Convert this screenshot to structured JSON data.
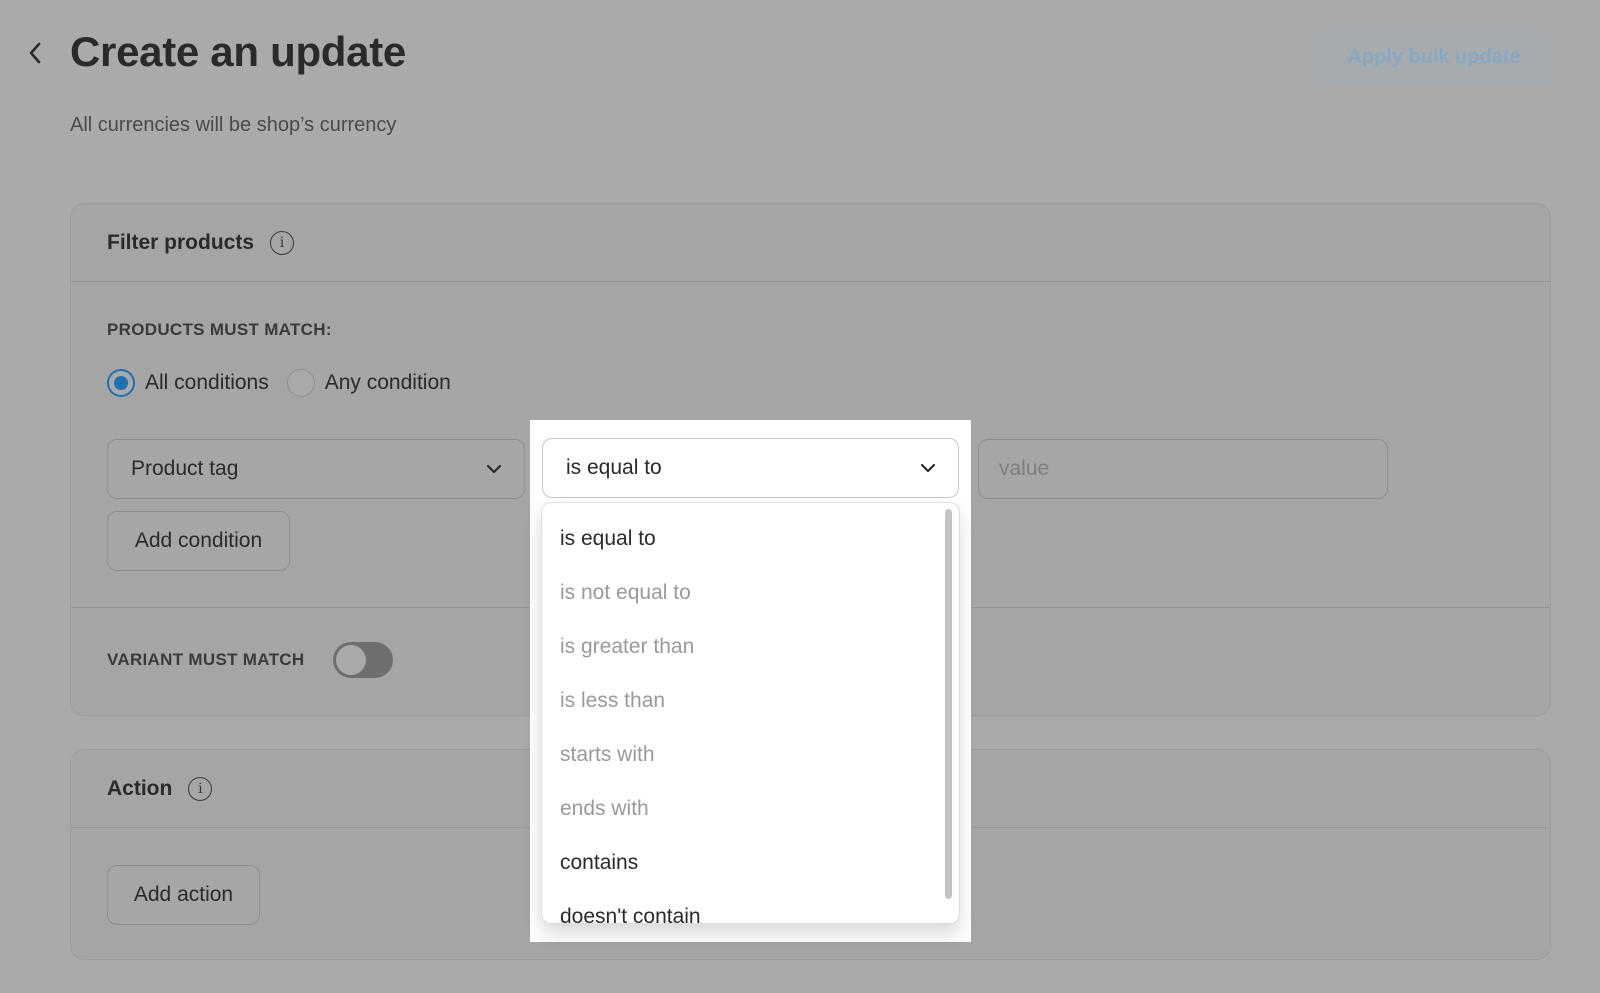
{
  "header": {
    "title": "Create an update",
    "subtitle": "All currencies will be shop’s currency",
    "apply_button": "Apply bulk update"
  },
  "filter_card": {
    "title": "Filter products",
    "match_label": "PRODUCTS MUST MATCH:",
    "radios": [
      {
        "label": "All conditions",
        "checked": true
      },
      {
        "label": "Any condition",
        "checked": false
      }
    ],
    "condition": {
      "field": "Product tag",
      "operator": "is equal to",
      "value_placeholder": "value"
    },
    "add_condition": "Add condition",
    "variant_label": "VARIANT MUST MATCH",
    "variant_toggle_on": false
  },
  "action_card": {
    "title": "Action",
    "add_action": "Add action"
  },
  "operator_dropdown": {
    "options": [
      {
        "label": "is equal to",
        "enabled": true
      },
      {
        "label": "is not equal to",
        "enabled": false
      },
      {
        "label": "is greater than",
        "enabled": false
      },
      {
        "label": "is less than",
        "enabled": false
      },
      {
        "label": "starts with",
        "enabled": false
      },
      {
        "label": "ends with",
        "enabled": false
      },
      {
        "label": "contains",
        "enabled": true
      },
      {
        "label": "doesn't contain",
        "enabled": true
      }
    ]
  },
  "colors": {
    "accent": "#1f6fb5",
    "overlay": "#aaaaaa",
    "enabled_text": "#2a2a2a",
    "disabled_text": "#9a9a9a"
  }
}
